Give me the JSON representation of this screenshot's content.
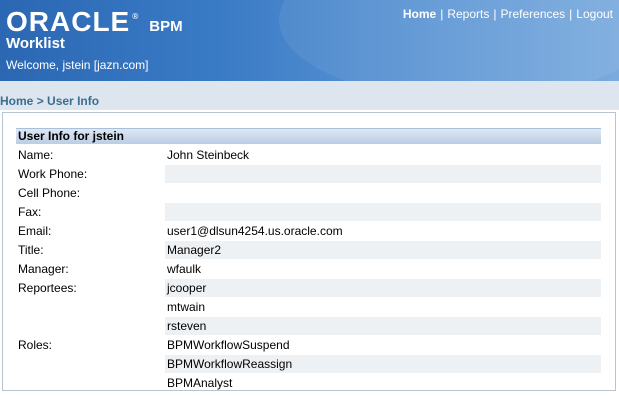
{
  "header": {
    "logo_text": "ORACLE",
    "logo_mark": "®",
    "product": "BPM",
    "app_title": "Worklist",
    "welcome": "Welcome, jstein [jazn.com]",
    "nav": [
      {
        "label": "Home"
      },
      {
        "label": "Reports"
      },
      {
        "label": "Preferences"
      },
      {
        "label": "Logout"
      }
    ],
    "nav_separator": "|"
  },
  "breadcrumb": {
    "home": "Home",
    "separator": ">",
    "current": "User Info"
  },
  "panel": {
    "title": "User Info for jstein",
    "rows": [
      {
        "label": "Name:",
        "value": "John Steinbeck"
      },
      {
        "label": "Work Phone:",
        "value": ""
      },
      {
        "label": "Cell Phone:",
        "value": ""
      },
      {
        "label": "Fax:",
        "value": ""
      },
      {
        "label": "Email:",
        "value": "user1@dlsun4254.us.oracle.com"
      },
      {
        "label": "Title:",
        "value": "Manager2"
      },
      {
        "label": "Manager:",
        "value": "wfaulk"
      },
      {
        "label": "Reportees:",
        "value": "jcooper"
      },
      {
        "label": "",
        "value": "mtwain"
      },
      {
        "label": "",
        "value": "rsteven"
      },
      {
        "label": "Roles:",
        "value": "BPMWorkflowSuspend"
      },
      {
        "label": "",
        "value": "BPMWorkflowReassign"
      },
      {
        "label": "",
        "value": "BPMAnalyst"
      }
    ]
  },
  "colors": {
    "header_blue": "#3a7bc6",
    "crumb_bg": "#dde6ef",
    "crumb_text": "#3c6e8f",
    "row_shade": "#eef1f4"
  }
}
